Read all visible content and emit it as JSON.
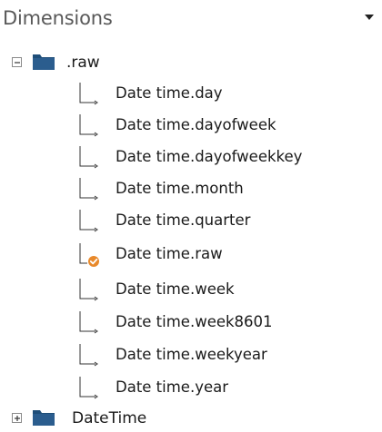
{
  "panel": {
    "title": "Dimensions"
  },
  "tree": {
    "raw_folder": {
      "label": ".raw",
      "expanded": true
    },
    "fields": [
      {
        "label": "Date time.day",
        "icon": "hierarchy-level-icon"
      },
      {
        "label": "Date time.dayofweek",
        "icon": "hierarchy-level-icon"
      },
      {
        "label": "Date time.dayofweekkey",
        "icon": "hierarchy-level-icon"
      },
      {
        "label": "Date time.month",
        "icon": "hierarchy-level-icon"
      },
      {
        "label": "Date time.quarter",
        "icon": "hierarchy-level-icon"
      },
      {
        "label": "Date time.raw",
        "icon": "hierarchy-level-checked-icon"
      },
      {
        "label": "Date time.week",
        "icon": "hierarchy-level-icon"
      },
      {
        "label": "Date time.week8601",
        "icon": "hierarchy-level-icon"
      },
      {
        "label": "Date time.weekyear",
        "icon": "hierarchy-level-icon"
      },
      {
        "label": "Date time.year",
        "icon": "hierarchy-level-icon"
      }
    ],
    "datetime_folder": {
      "label": "DateTime",
      "expanded": false
    }
  },
  "colors": {
    "folder": "#1f4e79",
    "check_badge": "#e8892b",
    "connector": "#333333"
  }
}
